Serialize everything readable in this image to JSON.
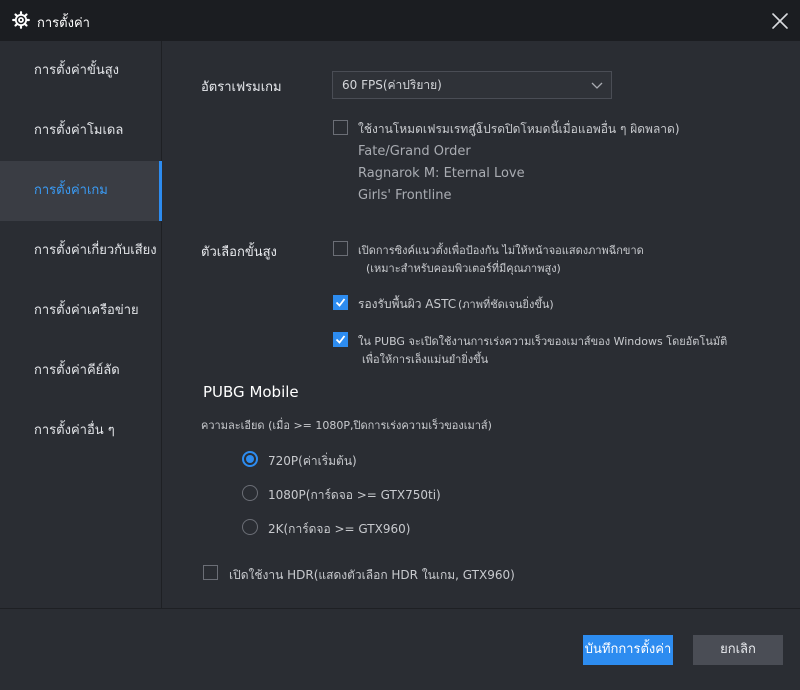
{
  "window": {
    "title": "การตั้งค่า",
    "gear_icon": "gear-icon",
    "close_icon": "close-icon"
  },
  "sidebar": {
    "items": [
      {
        "label": "การตั้งค่าขั้นสูง",
        "active": false
      },
      {
        "label": "การตั้งค่าโมเดล",
        "active": false
      },
      {
        "label": "การตั้งค่าเกม",
        "active": true
      },
      {
        "label": "การตั้งค่าเกี่ยวกับเสียง",
        "active": false
      },
      {
        "label": "การตั้งค่าเครือข่าย",
        "active": false
      },
      {
        "label": "การตั้งค่าคีย์ลัด",
        "active": false
      },
      {
        "label": "การตั้งค่าอื่น ๆ",
        "active": false
      }
    ]
  },
  "game": {
    "fps_label": "อัตราเฟรมเกม",
    "fps_value": "60 FPS(ค่าปริยาย)",
    "high_fps_label": "ใช้งานโหมดเฟรมเรทสูง",
    "high_fps_note": "(โปรดปิดโหมดนี้เมื่อแอพอื่น ๆ ผิดพลาด)",
    "high_fps_checked": false,
    "games": [
      "Fate/Grand Order",
      "Ragnarok M: Eternal Love",
      "Girls' Frontline"
    ],
    "advanced_label": "ตัวเลือกขั้นสูง",
    "vsync_label": "เปิดการซิงค์แนวตั้งเพื่อป้องกัน ไม่ให้หน้าจอแสดงภาพฉีกขาด",
    "vsync_note": "(เหมาะสำหรับคอมพิวเตอร์ที่มีคุณภาพสูง)",
    "vsync_checked": false,
    "astc_label": "รองรับพื้นผิว ASTC",
    "astc_note": "(ภาพที่ชัดเจนยิ่งขึ้น)",
    "astc_checked": true,
    "pubg_mouse_label": "ใน PUBG จะเปิดใช้งานการเร่งความเร็วของเมาส์ของ Windows โดยอัตโนมัติ",
    "pubg_mouse_note": "เพื่อให้การเล็งแม่นยำยิ่งขึ้น",
    "pubg_mouse_checked": true
  },
  "pubg": {
    "heading": "PUBG Mobile",
    "resolution_label": "ความละเอียด (เมื่อ >= 1080P,ปิดการเร่งความเร็วของเมาส์)",
    "options": [
      {
        "label": "720P(ค่าเริ่มต้น)",
        "selected": true
      },
      {
        "label": "1080P(การ์ดจอ >= GTX750ti)",
        "selected": false
      },
      {
        "label": "2K(การ์ดจอ >= GTX960)",
        "selected": false
      }
    ],
    "hdr_label": "เปิดใช้งาน HDR(แสดงตัวเลือก HDR ในเกม, GTX960)",
    "hdr_checked": false
  },
  "footer": {
    "save_label": "บันทึกการตั้งค่า",
    "cancel_label": "ยกเลิก"
  },
  "colors": {
    "accent": "#2d8cf0",
    "background": "#2a2d33",
    "titlebar": "#1b1d21"
  }
}
